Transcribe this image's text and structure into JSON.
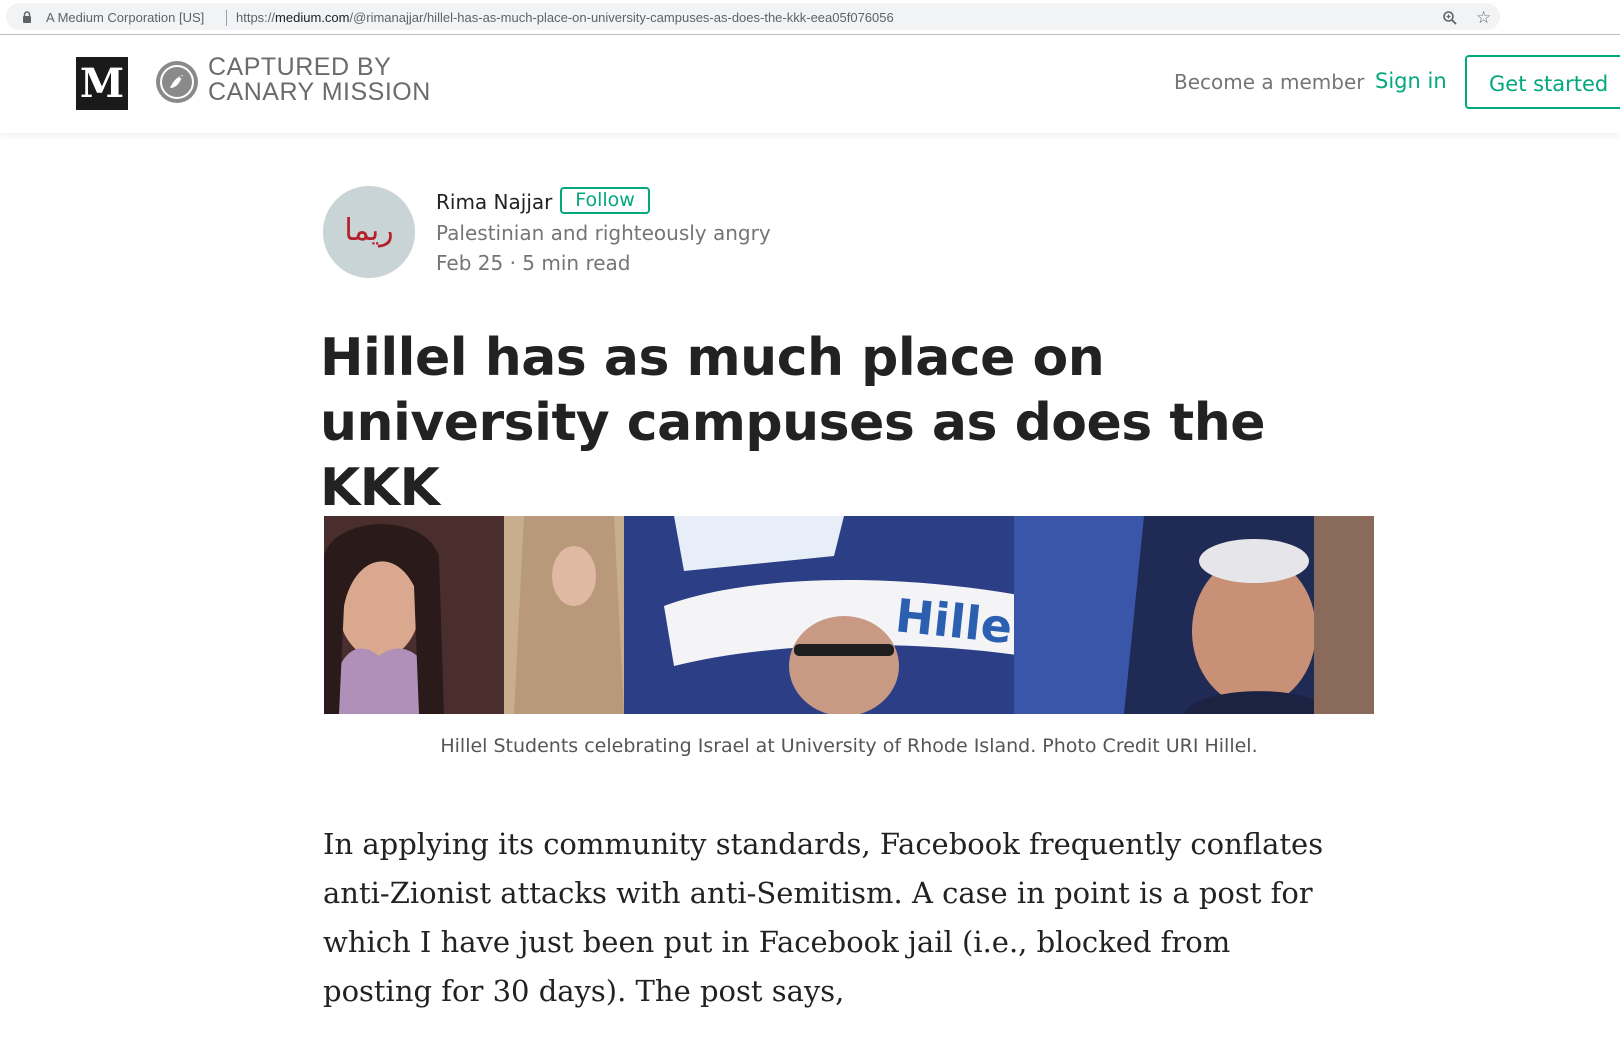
{
  "browser": {
    "site_identity": "A Medium Corporation [US]",
    "url_prefix": "https://",
    "url_host": "medium.com",
    "url_path": "/@rimanajjar/hillel-has-as-much-place-on-university-campuses-as-does-the-kkk-eea05f076056",
    "icons": [
      "lock-icon",
      "zoom-icon",
      "star-icon"
    ]
  },
  "header": {
    "logo_letter": "M",
    "publication_line1": "CAPTURED BY",
    "publication_line2": "CANARY MISSION",
    "become_member": "Become a member",
    "sign_in": "Sign in",
    "get_started": "Get started"
  },
  "author": {
    "name": "Rima Najjar",
    "follow_label": "Follow",
    "bio": "Palestinian and righteously angry",
    "date": "Feb 25",
    "separator": "·",
    "read_time": "5 min read",
    "avatar_text": "ريما"
  },
  "article": {
    "title": "Hillel has as much place on university campuses as does the KKK",
    "image_sign_text": "Hillel",
    "image_caption": "Hillel Students celebrating Israel at University of Rhode Island. Photo Credit URI Hillel.",
    "paragraph": "In applying its community standards, Facebook frequently conflates anti-Zionist attacks with anti-Semitism. A case in point is a post for which I have just been put in Facebook jail (i.e., blocked from posting for 30 days). The post says,"
  },
  "colors": {
    "accent_green": "#03a87c",
    "text_dark": "#222222",
    "text_muted": "#757575"
  }
}
